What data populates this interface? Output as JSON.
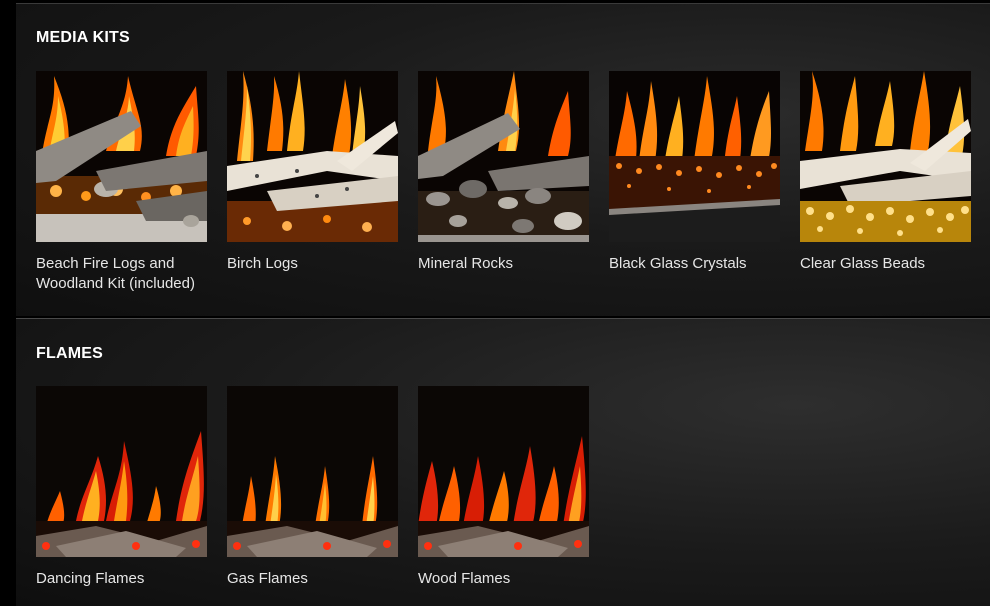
{
  "media_kits": {
    "title": "MEDIA KITS",
    "items": [
      {
        "label": "Beach Fire Logs and Woodland Kit (included)",
        "icon": "beach-fire-logs-image"
      },
      {
        "label": "Birch Logs",
        "icon": "birch-logs-image"
      },
      {
        "label": "Mineral Rocks",
        "icon": "mineral-rocks-image"
      },
      {
        "label": "Black Glass Crystals",
        "icon": "black-glass-crystals-image"
      },
      {
        "label": "Clear Glass Beads",
        "icon": "clear-glass-beads-image"
      }
    ]
  },
  "flames": {
    "title": "FLAMES",
    "items": [
      {
        "label": "Dancing Flames",
        "icon": "dancing-flames-image"
      },
      {
        "label": "Gas Flames",
        "icon": "gas-flames-image"
      },
      {
        "label": "Wood Flames",
        "icon": "wood-flames-image"
      }
    ]
  },
  "colors": {
    "background": "#000000",
    "panel": "#1a1a1a",
    "flame_orange": "#ff7a00",
    "flame_yellow": "#ffcc33",
    "flame_red": "#d81e05"
  }
}
